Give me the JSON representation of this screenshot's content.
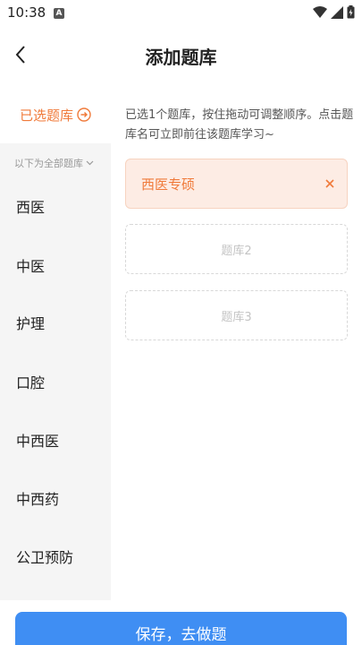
{
  "status_bar": {
    "time": "10:38",
    "notification_badge": "A"
  },
  "header": {
    "title": "添加题库",
    "back_icon": "chevron-left-icon"
  },
  "selected": {
    "label": "已选题库",
    "icon": "arrow-right-circle-icon",
    "accent": "#f07a3a"
  },
  "hint": "已选1个题库，按住拖动可调整顺序。点击题库名可立即前往该题库学习~",
  "slots": {
    "filled": {
      "label": "西医专硕",
      "close_icon": "close-icon"
    },
    "empty": [
      {
        "label": "题库2"
      },
      {
        "label": "题库3"
      }
    ]
  },
  "sidebar": {
    "all_label": "以下为全部题库",
    "items": [
      {
        "label": "西医"
      },
      {
        "label": "中医"
      },
      {
        "label": "护理"
      },
      {
        "label": "口腔"
      },
      {
        "label": "中西医"
      },
      {
        "label": "中西药"
      },
      {
        "label": "公卫预防"
      }
    ]
  },
  "footer": {
    "save_label": "保存，去做题",
    "button_color": "#3f8ef3"
  }
}
